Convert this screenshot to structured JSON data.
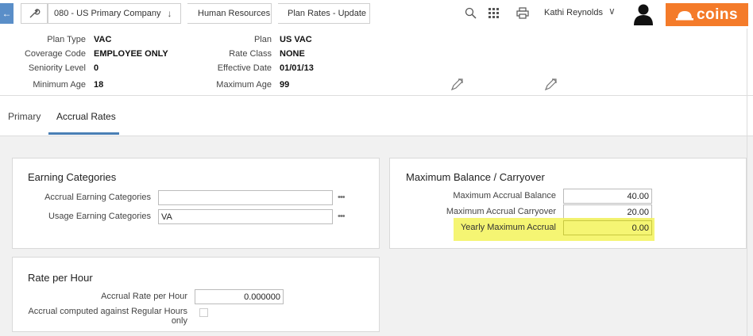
{
  "breadcrumbs": {
    "company": "080 - US Primary Company",
    "company_chevron": "↓",
    "module": "Human Resources",
    "page": "Plan Rates - Update"
  },
  "user": {
    "name": "Kathi Reynolds",
    "chevron": "∨"
  },
  "logo": {
    "text": "coins",
    "color": "#f47b2a"
  },
  "icons": {
    "back": "arrow-left-icon",
    "tool": "wrench-icon",
    "search": "search-icon",
    "apps": "grid-icon",
    "print": "printer-icon",
    "avatar": "user-avatar-icon",
    "edit": "edit-pencil-icon"
  },
  "header": {
    "plan_type_label": "Plan Type",
    "plan_type_value": "VAC",
    "coverage_code_label": "Coverage Code",
    "coverage_code_value": "EMPLOYEE ONLY",
    "seniority_level_label": "Seniority Level",
    "seniority_level_value": "0",
    "minimum_age_label": "Minimum Age",
    "minimum_age_value": "18",
    "plan_label": "Plan",
    "plan_value": "US VAC",
    "rate_class_label": "Rate Class",
    "rate_class_value": "NONE",
    "effective_date_label": "Effective Date",
    "effective_date_value": "01/01/13",
    "maximum_age_label": "Maximum Age",
    "maximum_age_value": "99"
  },
  "tabs": [
    {
      "label": "Primary",
      "active": false
    },
    {
      "label": "Accrual Rates",
      "active": true
    }
  ],
  "earning_categories": {
    "title": "Earning Categories",
    "accrual_label": "Accrual Earning Categories",
    "accrual_value": "",
    "usage_label": "Usage Earning Categories",
    "usage_value": "VA",
    "more": "•••"
  },
  "max_balance": {
    "title": "Maximum Balance / Carryover",
    "max_accrual_balance_label": "Maximum Accrual Balance",
    "max_accrual_balance_value": "40.00",
    "max_accrual_carryover_label": "Maximum Accrual Carryover",
    "max_accrual_carryover_value": "20.00",
    "yearly_max_accrual_label": "Yearly Maximum Accrual",
    "yearly_max_accrual_value": "0.00",
    "highlight_color": "#f3f35a"
  },
  "rate_per_hour": {
    "title": "Rate per Hour",
    "accrual_rate_label": "Accrual Rate per Hour",
    "accrual_rate_value": "0.000000",
    "regular_hours_label": "Accrual computed against Regular Hours only",
    "regular_hours_checked": false
  }
}
